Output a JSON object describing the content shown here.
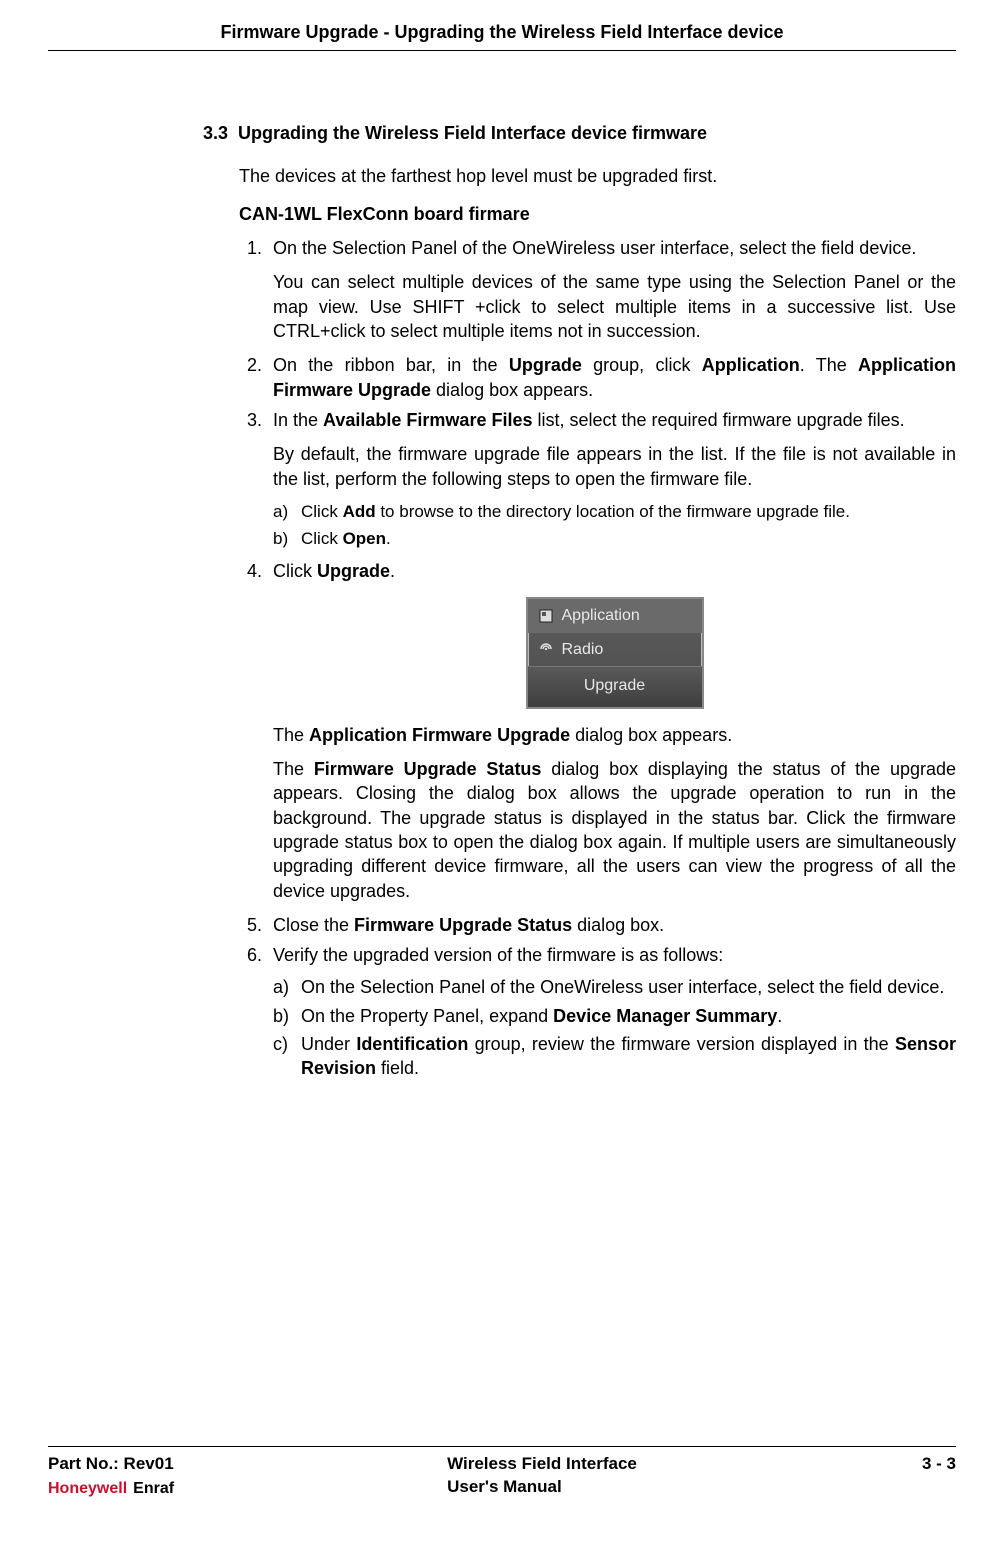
{
  "header": {
    "title": "Firmware Upgrade - Upgrading the Wireless Field Interface device"
  },
  "section": {
    "number": "3.3",
    "title": "Upgrading the Wireless Field Interface device firmware",
    "intro": "The devices at the farthest hop level must be upgraded first.",
    "subheading": "CAN-1WL FlexConn board firmare"
  },
  "steps": {
    "s1": {
      "text": "On the Selection Panel of the OneWireless user interface, select the field device.",
      "note": "You can select multiple devices of the same type using the Selection Panel or the map view. Use SHIFT +click to select multiple items in a successive list. Use CTRL+click to select multiple items not in succession."
    },
    "s2": {
      "pre": "On the ribbon bar, in the ",
      "b1": "Upgrade",
      "mid1": " group, click ",
      "b2": "Application",
      "mid2": ". The ",
      "b3": "Application Firmware Upgrade",
      "post": " dialog box appears."
    },
    "s3": {
      "pre": "In the ",
      "b1": "Available Firmware Files",
      "post1": " list, select the required firmware upgrade files.",
      "note": "By default, the firmware upgrade file appears in the list. If the file is not available in the list, perform the following steps to open the firmware file.",
      "a_pre": "Click ",
      "a_b": "Add",
      "a_post": " to browse to the directory location of the firmware upgrade file.",
      "b_pre": "Click ",
      "b_b": "Open",
      "b_post": "."
    },
    "s4": {
      "pre": "Click ",
      "b1": "Upgrade",
      "post": "."
    },
    "panel": {
      "item1": "Application",
      "item2": "Radio",
      "button": "Upgrade"
    },
    "after_panel": {
      "p1_pre": "The ",
      "p1_b": "Application Firmware Upgrade",
      "p1_post": " dialog box appears.",
      "p2_pre": "The ",
      "p2_b": "Firmware Upgrade Status",
      "p2_post": " dialog box displaying the status of the upgrade appears. Closing the dialog box allows the upgrade operation to run in the background. The upgrade status is displayed in the status bar. Click the firmware upgrade status box to open the dialog box again. If multiple users are simultaneously upgrading different device firmware, all the users can view the progress of all the device upgrades."
    },
    "s5": {
      "pre": "Close the ",
      "b1": "Firmware Upgrade Status",
      "post": " dialog box."
    },
    "s6": {
      "text": "Verify the upgraded version of the firmware is as follows:",
      "a": "On the Selection Panel of the OneWireless user interface, select the field device.",
      "b_pre": "On the Property Panel, expand ",
      "b_b": "Device Manager Summary",
      "b_post": ".",
      "c_pre": "Under ",
      "c_b1": "Identification",
      "c_mid": " group, review the firmware version displayed in the ",
      "c_b2": "Sensor Revision",
      "c_post": " field."
    }
  },
  "footer": {
    "part": "Part No.: Rev01",
    "brand_h": "Honeywell",
    "brand_e": "Enraf",
    "doc1": "Wireless Field Interface",
    "doc2": "User's Manual",
    "page": "3 - 3"
  }
}
